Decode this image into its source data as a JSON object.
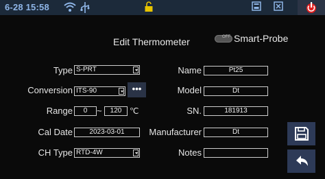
{
  "status_bar": {
    "time": "6-28 15:58",
    "icons": [
      "wifi-icon",
      "usb-icon",
      "unlock-icon",
      "save-card-icon",
      "close-box-icon",
      "power-icon"
    ]
  },
  "title": "Edit Thermometer",
  "smart_probe": {
    "label": "Smart-Probe",
    "state": "off"
  },
  "fields": {
    "type": {
      "label": "Type",
      "value": "S-PRT"
    },
    "conversion": {
      "label": "Conversion",
      "value": "ITS-90",
      "more": "•••"
    },
    "range": {
      "label": "Range",
      "min": "0",
      "max": "120",
      "separator": "~",
      "unit": "℃"
    },
    "cal_date": {
      "label": "Cal Date",
      "value": "2023-03-01"
    },
    "ch_type": {
      "label": "CH Type",
      "value": "RTD-4W"
    },
    "name": {
      "label": "Name",
      "value": "Pt25"
    },
    "model": {
      "label": "Model",
      "value": "Dt"
    },
    "sn": {
      "label": "SN.",
      "value": "181913"
    },
    "manufacturer": {
      "label": "Manufacturer",
      "value": "Dt"
    },
    "notes": {
      "label": "Notes",
      "value": ""
    }
  },
  "side_buttons": [
    "save-icon",
    "back-arrow-icon"
  ],
  "colors": {
    "status_bar": "#1c2a3a",
    "accent": "#2d3a57",
    "power_icon": "#e02020"
  }
}
